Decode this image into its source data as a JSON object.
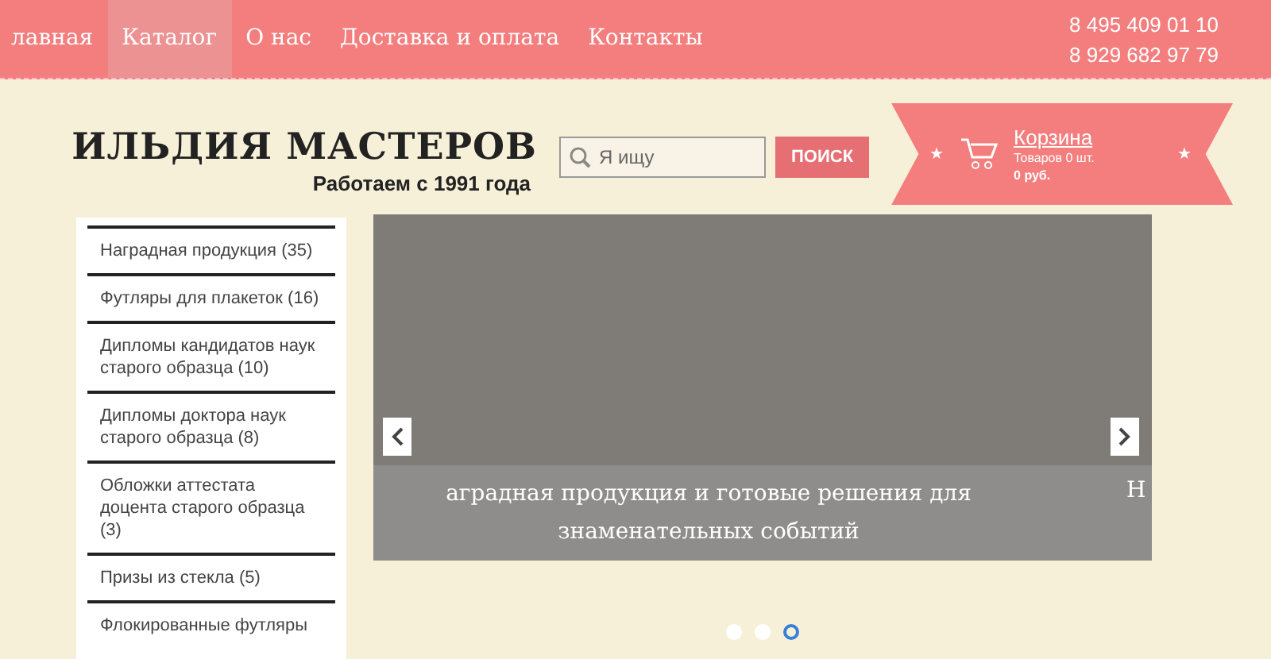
{
  "nav": {
    "items": [
      {
        "label": "лавная",
        "selected": false
      },
      {
        "label": "Каталог",
        "selected": true
      },
      {
        "label": "О нас",
        "selected": false
      },
      {
        "label": "Доставка и оплата",
        "selected": false
      },
      {
        "label": "Контакты",
        "selected": false
      }
    ],
    "phones": [
      "8 495 409 01 10",
      "8 929 682 97 79"
    ]
  },
  "logo": {
    "title": "ИЛЬДИЯ МАСТЕРОВ",
    "tagline": "Работаем с 1991 года"
  },
  "search": {
    "placeholder": "Я ищу",
    "button": "ПОИСК"
  },
  "cart": {
    "stars": [
      "★",
      "★"
    ],
    "title": "Корзина",
    "count": "Товаров 0 шт.",
    "total": "0 руб."
  },
  "sidebar": {
    "items": [
      "Наградная продукция (35)",
      "Футляры для плакеток (16)",
      "Дипломы кандидатов наук старого образца (10)",
      "Дипломы доктора наук старого образца (8)",
      "Обложки аттестата доцента старого образца (3)",
      "Призы из стекла (5)",
      "Флокированные футляры"
    ]
  },
  "slider": {
    "caption": [
      "аградная продукция и готовые решения для",
      "знаменательных событий"
    ],
    "next_caption": "Н",
    "dots": [
      {
        "selected": false
      },
      {
        "selected": false
      },
      {
        "selected": true
      }
    ]
  }
}
